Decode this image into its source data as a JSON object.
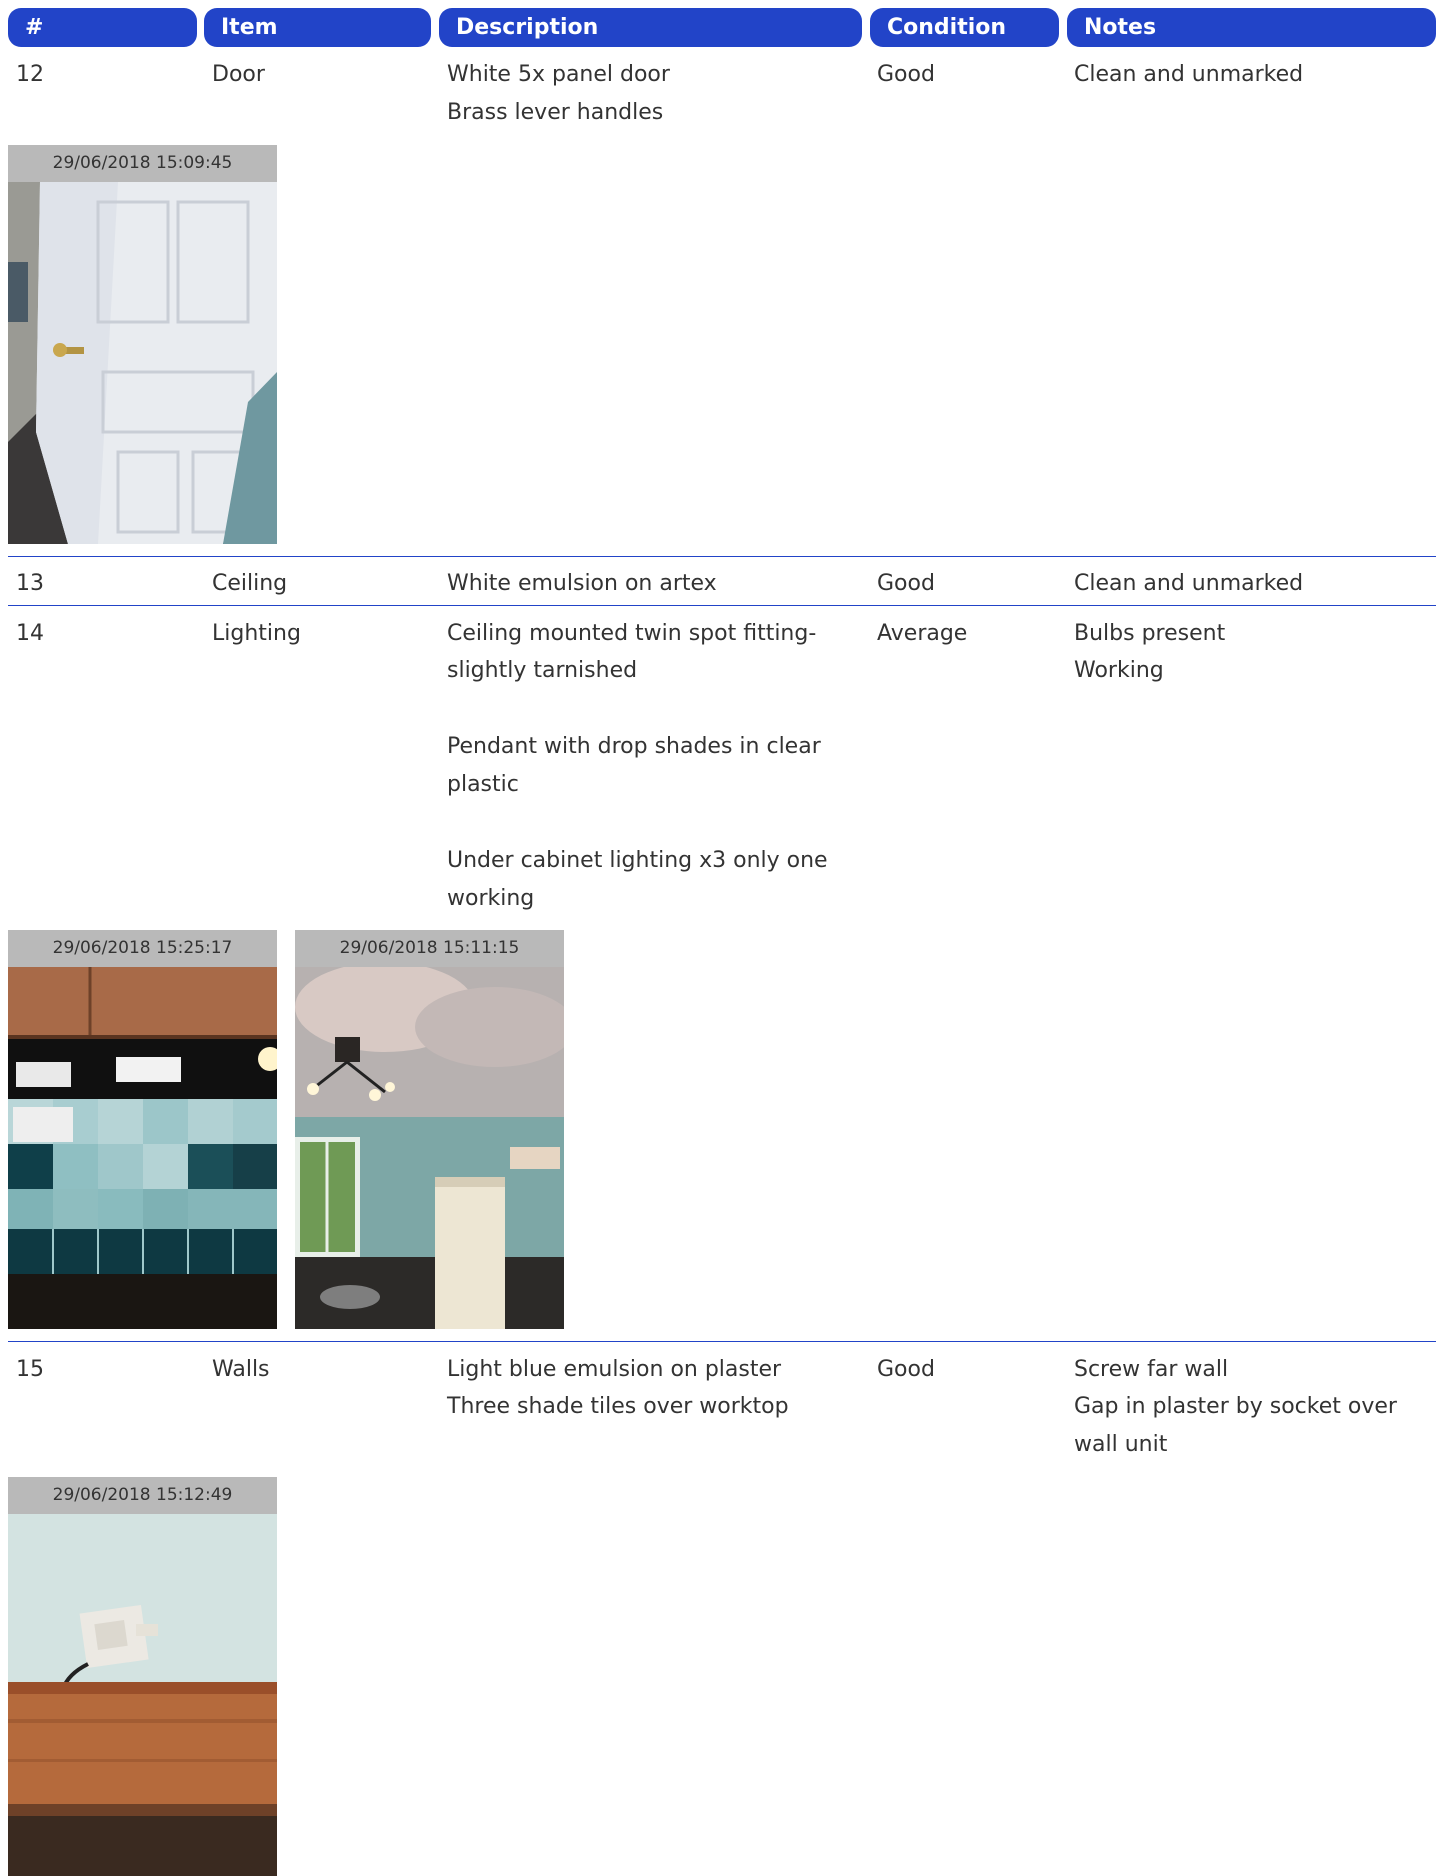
{
  "headers": {
    "num": "#",
    "item": "Item",
    "description": "Description",
    "condition": "Condition",
    "notes": "Notes"
  },
  "rows": [
    {
      "num": "12",
      "item": "Door",
      "description": [
        "White 5x panel door",
        "Brass lever handles"
      ],
      "condition": "Good",
      "notes": [
        "Clean and unmarked"
      ],
      "photos": [
        {
          "timestamp": "29/06/2018 15:09:45",
          "subject": "white panel door with brass lever handle"
        }
      ]
    },
    {
      "num": "13",
      "item": "Ceiling",
      "description": [
        "White emulsion on artex"
      ],
      "condition": "Good",
      "notes": [
        "Clean and unmarked"
      ],
      "photos": []
    },
    {
      "num": "14",
      "item": "Lighting",
      "description": [
        "Ceiling mounted twin spot fitting-",
        "slightly tarnished",
        "",
        "Pendant with drop shades in clear",
        "plastic",
        "",
        "Under cabinet lighting x3 only one",
        "working"
      ],
      "condition": "Average",
      "notes": [
        "Bulbs present",
        "Working"
      ],
      "photos": [
        {
          "timestamp": "29/06/2018 15:25:17",
          "subject": "under cabinet lights over teal tiles"
        },
        {
          "timestamp": "29/06/2018 15:11:15",
          "subject": "ceiling spot fitting and pendant"
        }
      ]
    },
    {
      "num": "15",
      "item": "Walls",
      "description": [
        "Light blue emulsion on plaster",
        "Three shade tiles over worktop"
      ],
      "condition": "Good",
      "notes": [
        "Screw far wall",
        "Gap in plaster by socket over",
        "wall unit"
      ],
      "photos": [
        {
          "timestamp": "29/06/2018 15:12:49",
          "subject": "wall socket above wooden cabinet"
        }
      ]
    }
  ]
}
